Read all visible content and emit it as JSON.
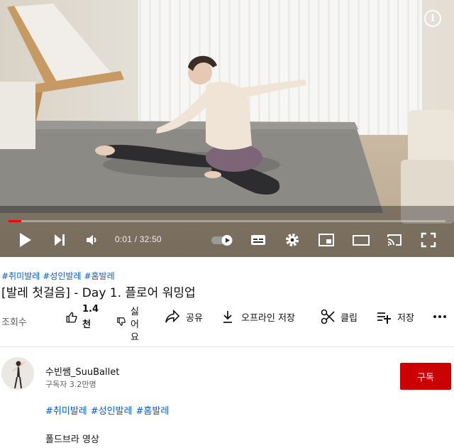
{
  "video": {
    "current_time": "0:01",
    "duration": "32:50",
    "progress_fraction": 0.0005,
    "info_icon_glyph": "i"
  },
  "hashtags": [
    "#취미발레",
    "#성인발레",
    "#홈발레"
  ],
  "title": "[발레 첫걸음] - Day 1. 플로어 워밍업",
  "actions": {
    "views_label": "조회수",
    "like_count_line1": "1.4",
    "like_count_line2": "천",
    "dislike_label_chars": [
      "싫",
      "어",
      "요"
    ],
    "share_label": "공유",
    "offline_label": "오프라인 저장",
    "clip_label": "클립",
    "save_label": "저장"
  },
  "channel": {
    "name": "수빈쌤_SuuBallet",
    "subscribers": "구독자 3.2만명",
    "subscribe_label": "구독"
  },
  "description": {
    "hashtags": [
      "#취미발레",
      "#성인발레",
      "#홈발레"
    ],
    "text": "폴드브라 영상"
  },
  "colors": {
    "link": "#065fd4",
    "subscribe_bg": "#cc0000",
    "progress": "#ff0000"
  }
}
